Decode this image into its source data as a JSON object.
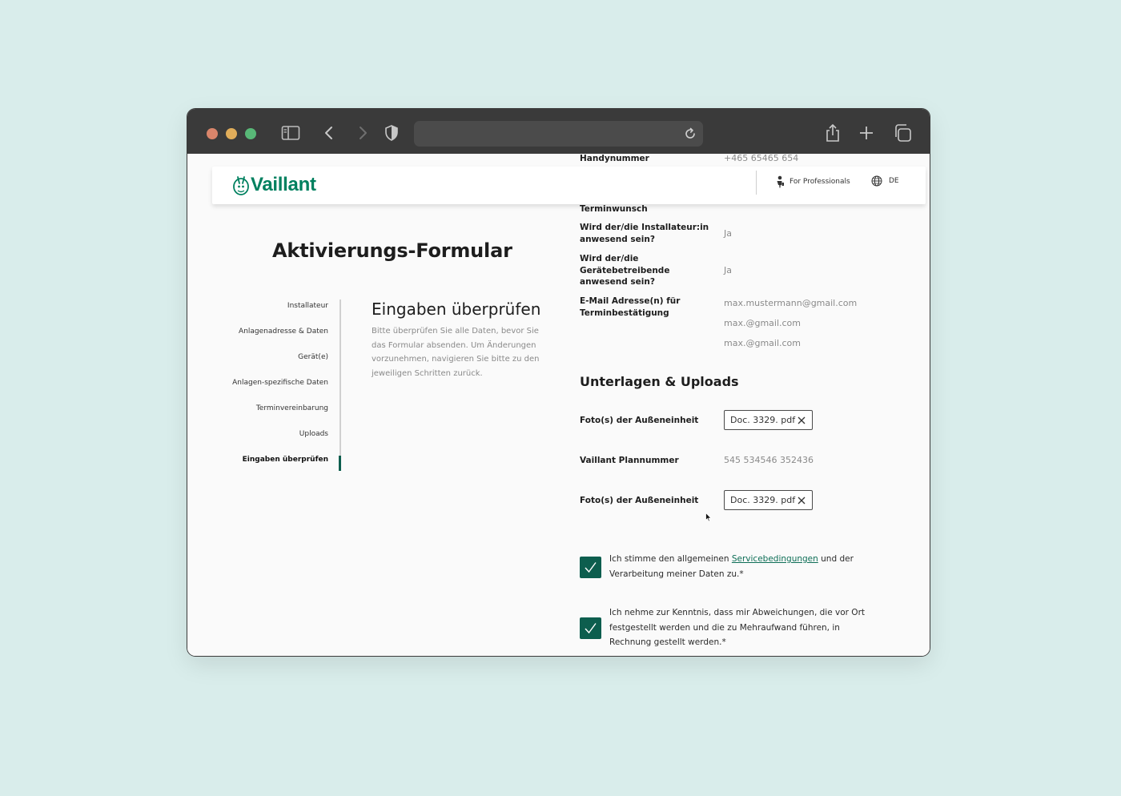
{
  "browser": {
    "icons": [
      "sidebar-icon",
      "back-icon",
      "forward-icon",
      "shield-icon",
      "reload-icon",
      "share-icon",
      "new-tab-icon",
      "tabs-icon"
    ]
  },
  "header": {
    "logo": "Vaillant",
    "for_professionals": "For Professionals",
    "language": "DE",
    "brand_color": "#00805f"
  },
  "page": {
    "title": "Aktivierungs-Formular"
  },
  "steps": [
    {
      "label": "Installateur"
    },
    {
      "label": "Anlagenadresse & Daten"
    },
    {
      "label": "Gerät(e)"
    },
    {
      "label": "Anlagen-spezifische Daten"
    },
    {
      "label": "Terminvereinbarung"
    },
    {
      "label": "Uploads"
    },
    {
      "label": "Eingaben überprüfen",
      "active": true
    }
  ],
  "review": {
    "title": "Eingaben überprüfen",
    "description": "Bitte überprüfen Sie alle Daten, bevor Sie das Formular absenden. Um Änderungen vorzunehmen, navigieren Sie bitte zu den jeweiligen Schritten zurück."
  },
  "contact": {
    "phone_label": "Handynummer",
    "phone_value": "+465 65465 654"
  },
  "appointment": {
    "section_label": "Terminwunsch",
    "installer_present_label": "Wird der/die Installateur:in anwesend sein?",
    "installer_present_value": "Ja",
    "operator_present_label": "Wird der/die Gerätebetreibende anwesend sein?",
    "operator_present_value": "Ja",
    "emails_label": "E-Mail Adresse(n) für Terminbestätigung",
    "emails": [
      "max.mustermann@gmail.com",
      "max.@gmail.com",
      "max.@gmail.com"
    ]
  },
  "uploads": {
    "title": "Unterlagen & Uploads",
    "photo1_label": "Foto(s) der Außeneinheit",
    "photo1_file": "Doc. 3329. pdf",
    "plan_label": "Vaillant Plannummer",
    "plan_value": "545 534546 352436",
    "photo2_label": "Foto(s) der Außeneinheit",
    "photo2_file": "Doc. 3329. pdf"
  },
  "consents": {
    "terms_before": "Ich stimme den allgemeinen ",
    "terms_link": "Servicebedingungen",
    "terms_after": " und der Verarbeitung meiner Daten zu.*",
    "deviation": "Ich nehme zur Kenntnis, dass mir Abweichungen, die vor Ort festgestellt werden und die zu Mehraufwand führen, in Rechnung gestellt werden.*",
    "checked_color": "#0d5e4e"
  }
}
